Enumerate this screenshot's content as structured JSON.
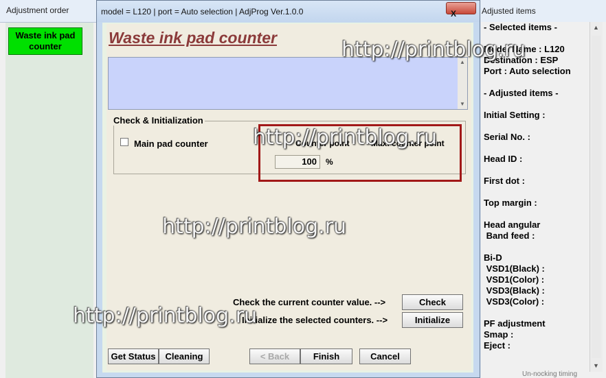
{
  "left_window": {
    "title": "Adjustment order",
    "waste_button_label": "Waste ink pad counter"
  },
  "right_window": {
    "title": "Adjusted items",
    "items": [
      "- Selected items -",
      "Model Name : L120",
      "Destination : ESP",
      "Port : Auto selection",
      "- Adjusted items -",
      "Initial Setting :",
      "Serial No. :",
      "Head ID :",
      "First dot :",
      "Top margin :",
      "Head angular",
      " Band feed :",
      "Bi-D",
      " VSD1(Black) :",
      " VSD1(Color) :",
      " VSD3(Black) :",
      " VSD3(Color) :",
      "PF adjustment",
      "Smap :",
      "Eject :"
    ],
    "footer": "Un-nocking timing"
  },
  "dialog": {
    "title": "model = L120 | port = Auto selection | AdjProg Ver.1.0.0",
    "close_label": "X",
    "heading": "Waste ink pad counter",
    "group_title": "Check & Initialization",
    "checkbox_label": "Main pad counter",
    "counter_col1": "Counter point",
    "counter_col2": "Max. counter point",
    "counter_value": "100",
    "percent": "%",
    "check_hint": "Check the current counter value. -->",
    "check_button": "Check",
    "init_hint": "Initialize the selected counters. -->",
    "init_button": "Initialize",
    "bottom_buttons": {
      "get_status": "Get Status",
      "cleaning": "Cleaning",
      "back": "< Back",
      "finish": "Finish",
      "cancel": "Cancel"
    }
  },
  "watermark": "http://printblog.ru"
}
